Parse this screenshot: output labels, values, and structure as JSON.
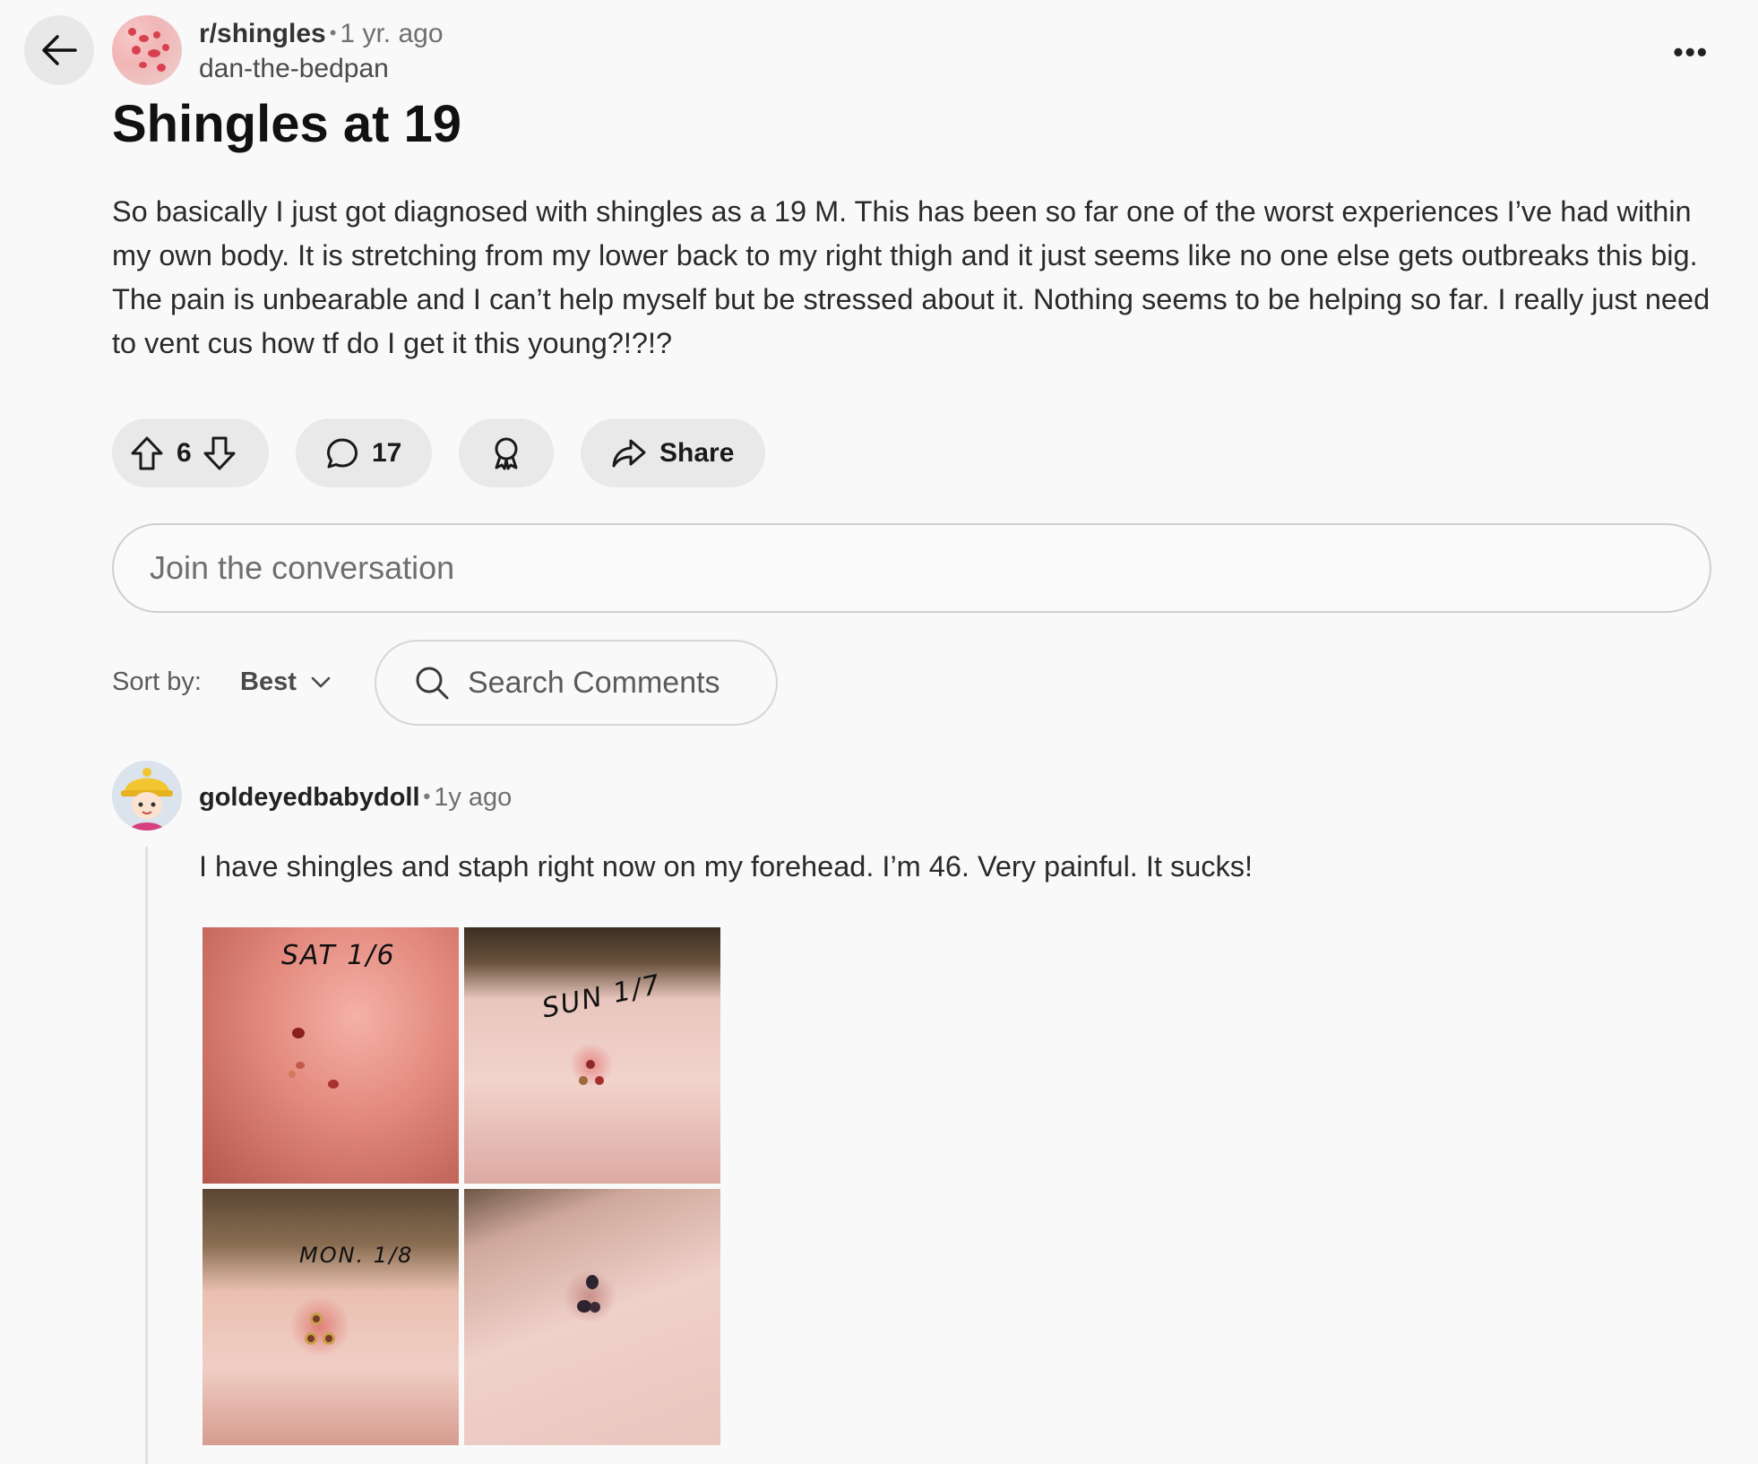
{
  "header": {
    "subreddit": "r/shingles",
    "age": "1 yr. ago",
    "author": "dan-the-bedpan",
    "more_label": "•••"
  },
  "post": {
    "title": "Shingles at 19",
    "body": "So basically I just got diagnosed with shingles as a 19 M. This has been so far one of the worst experiences I’ve had within my own body. It is stretching from my lower back to my right thigh and it just seems like no one else gets outbreaks this big. The pain is unbearable and I can’t help myself but be stressed about it. Nothing seems to be helping so far. I really just need to vent cus how tf do I get it this young?!?!?"
  },
  "actions": {
    "votes": "6",
    "comments": "17",
    "share_label": "Share"
  },
  "join": {
    "placeholder": "Join the conversation"
  },
  "sort": {
    "label": "Sort by:",
    "value": "Best",
    "search_placeholder": "Search Comments"
  },
  "comment": {
    "author": "goldeyedbabydoll",
    "age": "1y ago",
    "text": "I have shingles and staph right now on my forehead. I’m 46. Very painful. It sucks!",
    "image_captions": [
      "SAT 1/6",
      "SUN 1/7",
      "MON. 1/8"
    ]
  },
  "icons": [
    "back-arrow-icon",
    "more-options-icon",
    "upvote-icon",
    "downvote-icon",
    "comment-icon",
    "award-icon",
    "share-icon",
    "chevron-down-icon",
    "search-icon"
  ]
}
